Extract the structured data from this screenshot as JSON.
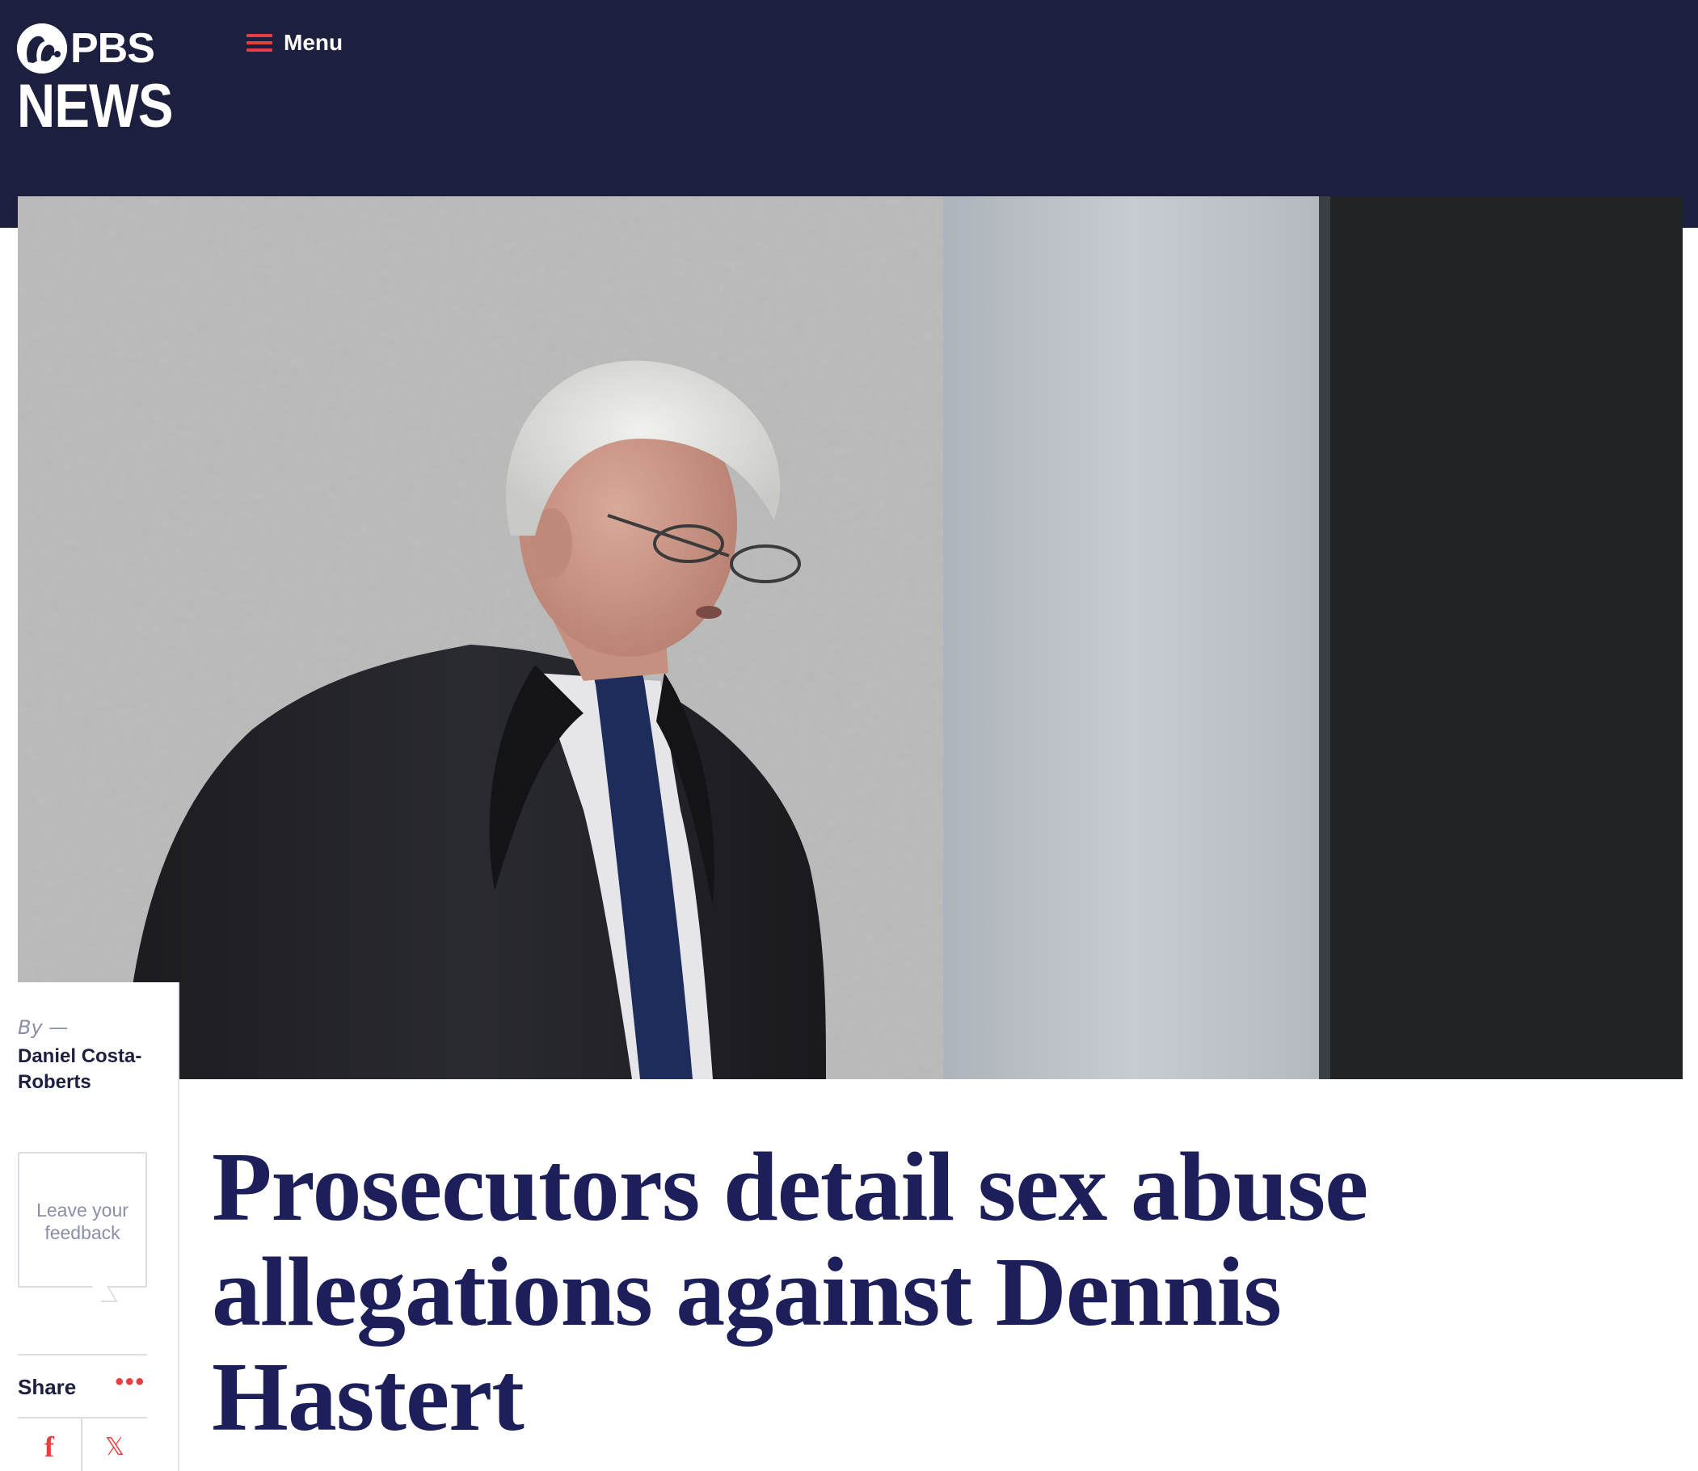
{
  "header": {
    "logo_top": "PBS",
    "logo_bottom": "NEWS",
    "menu_label": "Menu"
  },
  "hero": {
    "icon": "hero-photo"
  },
  "byline": {
    "prefix": "By —",
    "author": "Daniel Costa-Roberts"
  },
  "feedback": {
    "label": "Leave your feedback"
  },
  "share": {
    "label": "Share",
    "more_icon": "more-dots-icon",
    "networks": [
      {
        "name": "facebook-icon",
        "glyph": "f"
      },
      {
        "name": "x-icon",
        "glyph": "𝕏"
      }
    ]
  },
  "article": {
    "headline": "Prosecutors detail sex abuse allegations against Dennis Hastert"
  },
  "colors": {
    "header_bg": "#1d1f3f",
    "accent": "#e5403f",
    "headline": "#1d1f5a"
  }
}
